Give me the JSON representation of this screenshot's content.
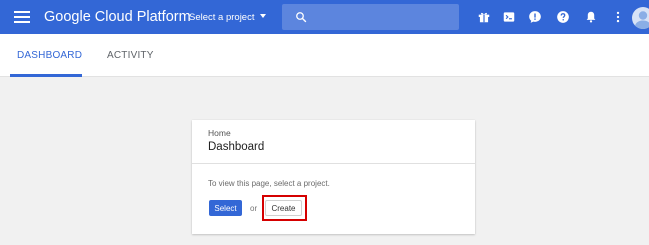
{
  "app": {
    "brand": "Google Cloud Platform",
    "project_selector": "Select a project"
  },
  "search": {
    "placeholder": ""
  },
  "toolbar_icons": [
    "gift-icon",
    "cloud-shell-icon",
    "notification-alert-icon",
    "help-icon",
    "bell-icon",
    "more-vert-icon",
    "avatar"
  ],
  "tabs": [
    {
      "label": "DASHBOARD",
      "active": true
    },
    {
      "label": "ACTIVITY",
      "active": false
    }
  ],
  "card": {
    "breadcrumb": "Home",
    "title": "Dashboard",
    "message": "To view this page, select a project.",
    "select_label": "Select",
    "or_text": "or",
    "create_label": "Create"
  },
  "colors": {
    "header": "#3367d6",
    "search": "#5c85de",
    "highlight": "#d50000"
  }
}
